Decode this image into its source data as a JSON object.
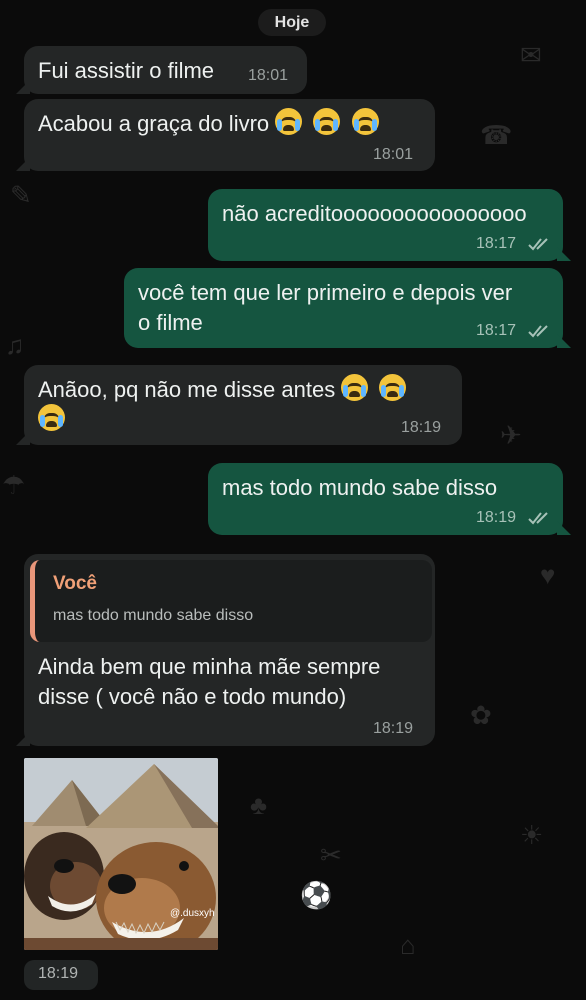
{
  "date_separator": "Hoje",
  "messages": [
    {
      "text": "Fui assistir o filme",
      "time": "18:01",
      "direction": "incoming"
    },
    {
      "text": "Acabou a graça do livro",
      "time": "18:01",
      "direction": "incoming",
      "emoji": "loudly-crying-face",
      "emoji_count": 3
    },
    {
      "text": "não acreditoooooooooooooooo",
      "time": "18:17",
      "direction": "outgoing",
      "status": "read"
    },
    {
      "lines": [
        "você tem que ler primeiro e depois ver",
        "o filme"
      ],
      "time": "18:17",
      "direction": "outgoing",
      "status": "read"
    },
    {
      "text": "Anãoo, pq não me disse antes",
      "time": "18:19",
      "direction": "incoming",
      "emoji": "loudly-crying-face",
      "emoji_count": 3
    },
    {
      "text": "mas todo mundo sabe disso",
      "time": "18:19",
      "direction": "outgoing",
      "status": "read"
    },
    {
      "quote": {
        "author": "Você",
        "text": "mas todo mundo sabe disso"
      },
      "lines": [
        "Ainda bem que minha mãe sempre",
        "disse ( você não e todo mundo)"
      ],
      "time": "18:19",
      "direction": "incoming"
    },
    {
      "type": "image",
      "image_watermark": "@.dusxyh",
      "time": "18:19",
      "direction": "incoming"
    }
  ],
  "colors": {
    "background": "#0b0b0b",
    "incoming_bubble": "#242626",
    "outgoing_bubble": "#155540",
    "quote_accent": "#e9967a"
  }
}
